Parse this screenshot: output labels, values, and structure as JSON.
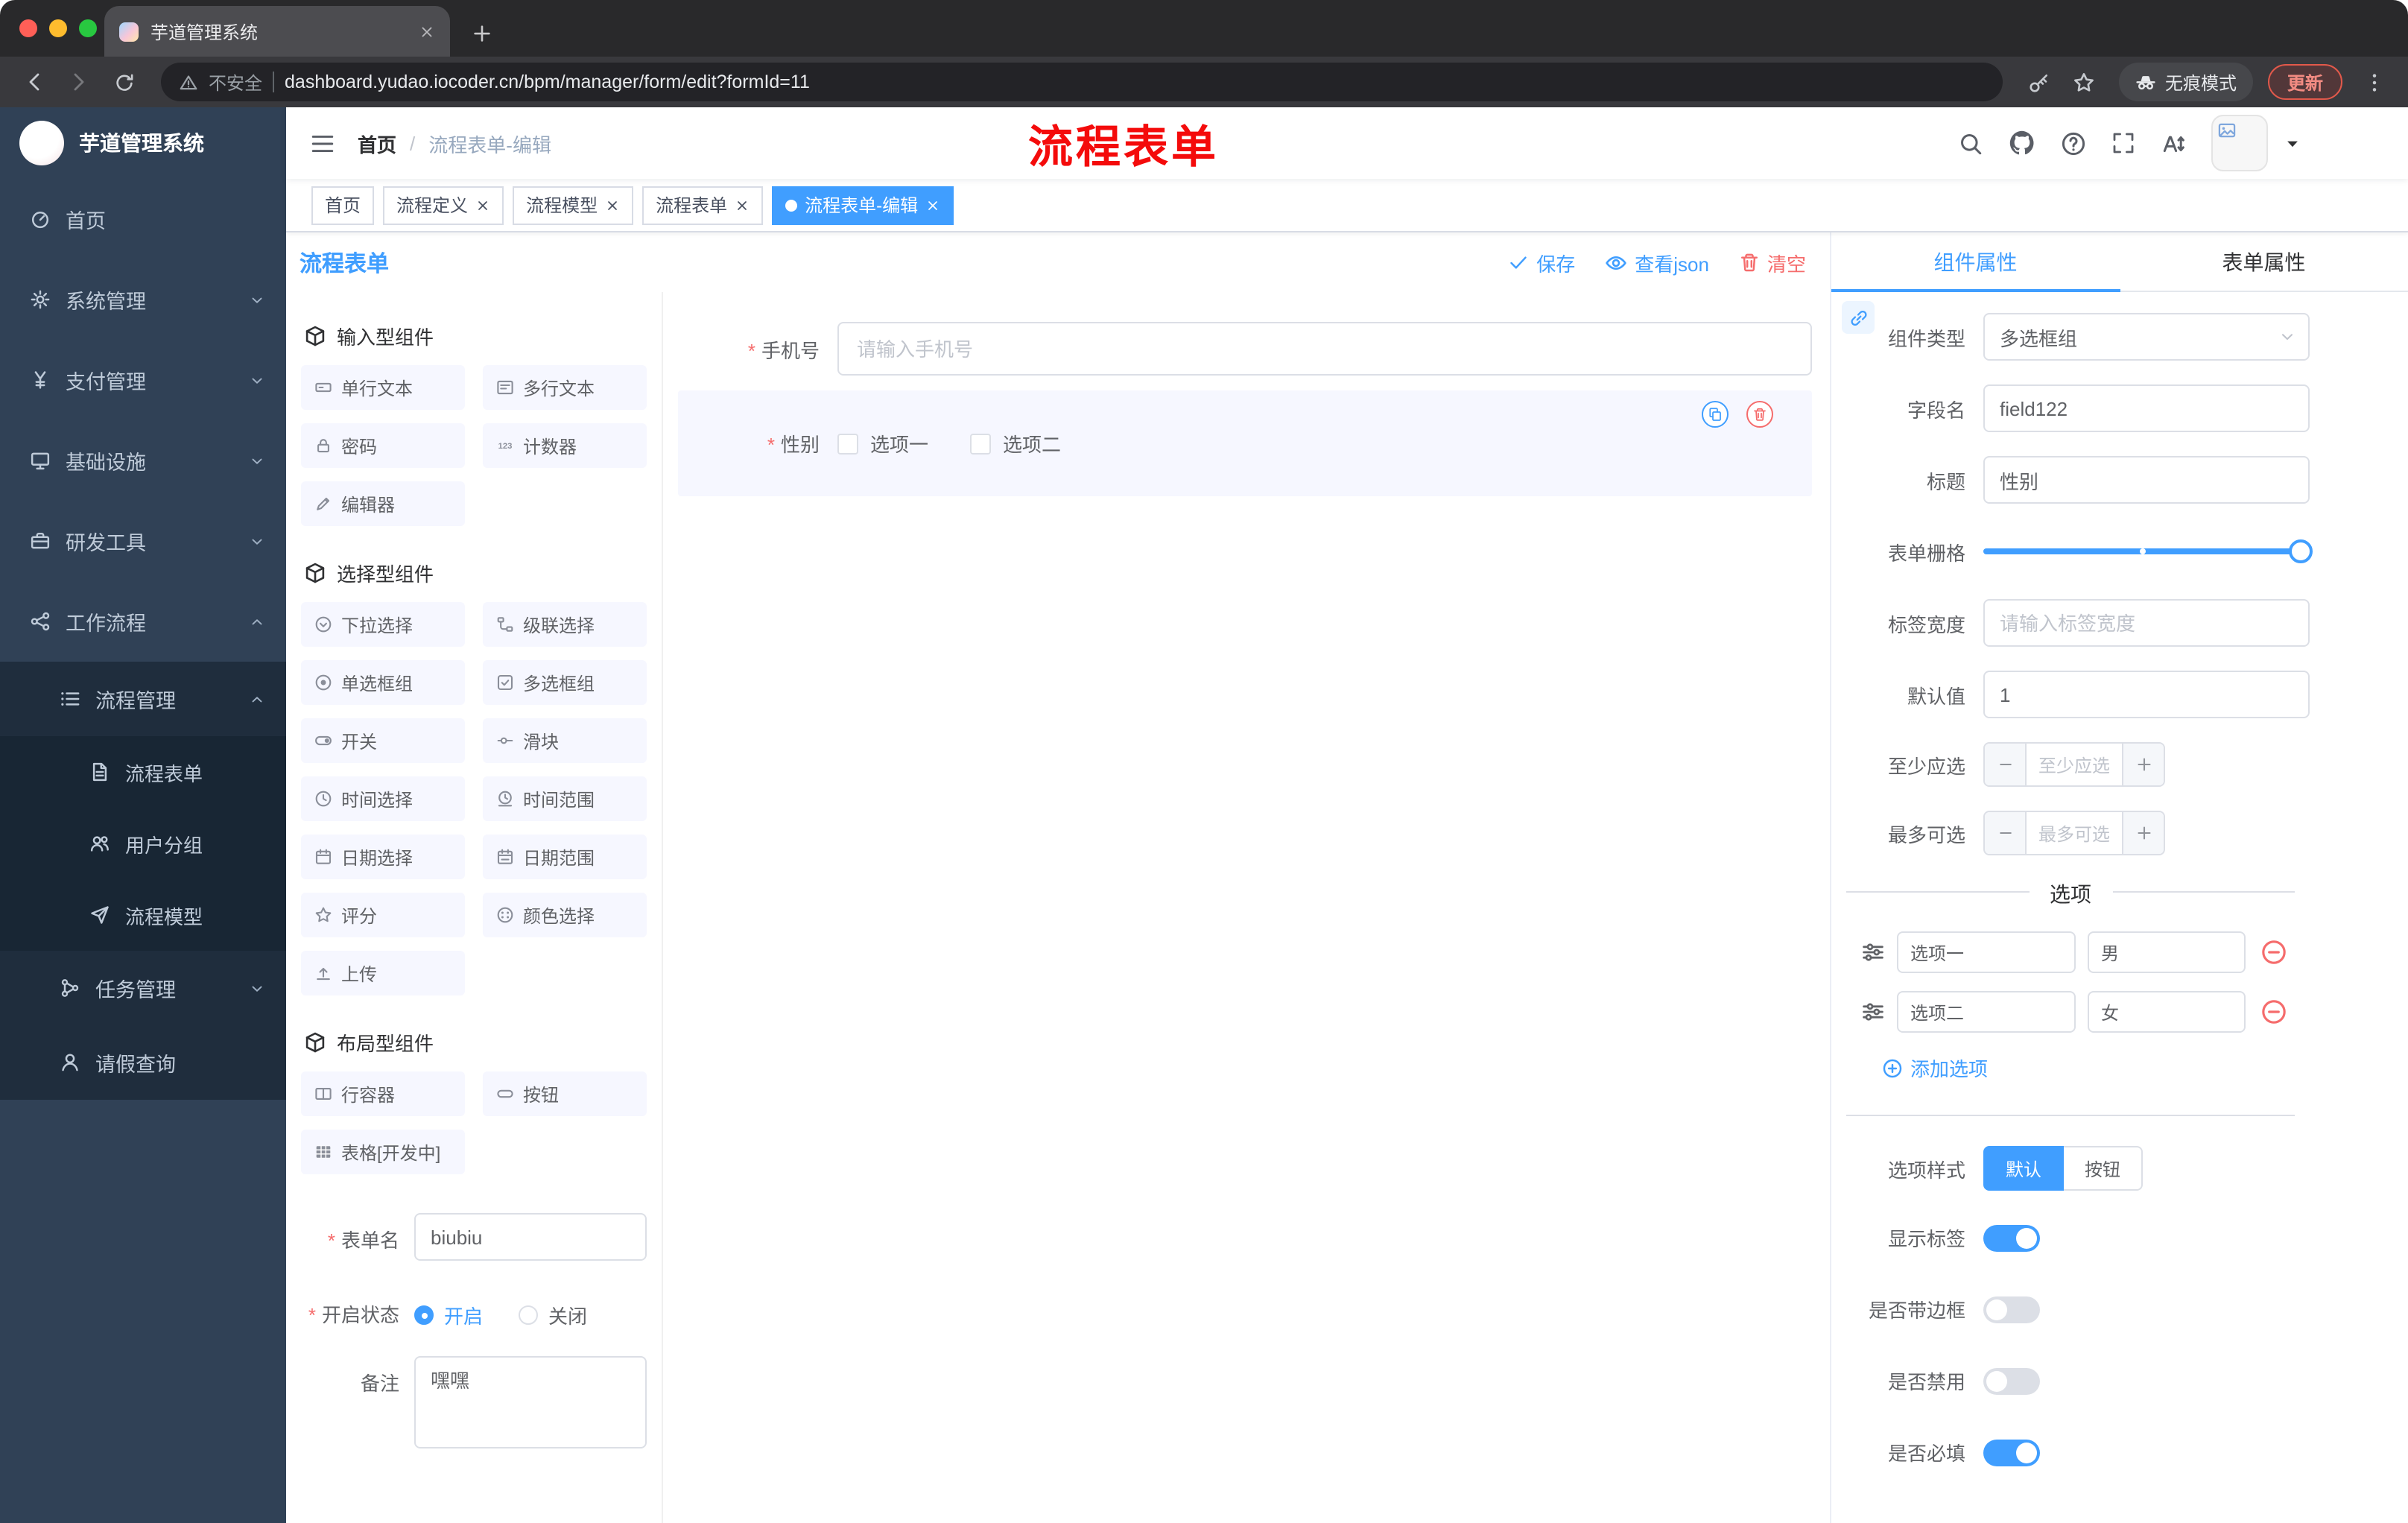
{
  "theme": {
    "primary": "#409eff",
    "danger": "#f56c6c",
    "sidebar_bg": "#304156",
    "submenu_bg": "#1f2d3d",
    "annotation_red": "#f40b0b"
  },
  "browser": {
    "tab_title": "芋道管理系统",
    "security_label": "不安全",
    "url": "dashboard.yudao.iocoder.cn/bpm/manager/form/edit?formId=11",
    "incognito_label": "无痕模式",
    "update_label": "更新"
  },
  "sidebar": {
    "app_title": "芋道管理系统",
    "items": [
      {
        "key": "home",
        "label": "首页",
        "icon": "dashboard",
        "depth": 0
      },
      {
        "key": "system",
        "label": "系统管理",
        "icon": "gear",
        "depth": 0,
        "chevron": "down"
      },
      {
        "key": "payment",
        "label": "支付管理",
        "icon": "yen",
        "depth": 0,
        "chevron": "down"
      },
      {
        "key": "infrastructure",
        "label": "基础设施",
        "icon": "infra",
        "depth": 0,
        "chevron": "down"
      },
      {
        "key": "devtools",
        "label": "研发工具",
        "icon": "toolbox",
        "depth": 0,
        "chevron": "down"
      },
      {
        "key": "workflow",
        "label": "工作流程",
        "icon": "workflow",
        "depth": 0,
        "chevron": "up",
        "open": true
      },
      {
        "key": "process-management",
        "label": "流程管理",
        "icon": "list",
        "depth": 1,
        "chevron": "up",
        "open": true
      },
      {
        "key": "process-form",
        "label": "流程表单",
        "icon": "form",
        "depth": 2,
        "active": true
      },
      {
        "key": "user-group",
        "label": "用户分组",
        "icon": "users",
        "depth": 2
      },
      {
        "key": "process-model",
        "label": "流程模型",
        "icon": "send",
        "depth": 2
      },
      {
        "key": "task-management",
        "label": "任务管理",
        "icon": "branch",
        "depth": 1,
        "chevron": "down"
      },
      {
        "key": "leave-query",
        "label": "请假查询",
        "icon": "user",
        "depth": 1
      }
    ]
  },
  "header": {
    "breadcrumb_home": "首页",
    "breadcrumb_separator": "/",
    "breadcrumb_current": "流程表单-编辑",
    "annotation": "流程表单"
  },
  "tags": [
    {
      "key": "home",
      "label": "首页",
      "closable": false,
      "active": false
    },
    {
      "key": "process-definition",
      "label": "流程定义",
      "closable": true,
      "active": false
    },
    {
      "key": "process-model",
      "label": "流程模型",
      "closable": true,
      "active": false
    },
    {
      "key": "process-form",
      "label": "流程表单",
      "closable": true,
      "active": false
    },
    {
      "key": "process-form-edit",
      "label": "流程表单-编辑",
      "closable": true,
      "active": true
    }
  ],
  "designer": {
    "title": "流程表单",
    "actions": {
      "save": "保存",
      "view_json": "查看json",
      "clear": "清空"
    },
    "palette_sections": [
      {
        "title": "输入型组件",
        "items": [
          {
            "label": "单行文本",
            "icon": "input"
          },
          {
            "label": "多行文本",
            "icon": "textarea"
          },
          {
            "label": "密码",
            "icon": "lock"
          },
          {
            "label": "计数器",
            "icon": "counter"
          },
          {
            "label": "编辑器",
            "icon": "editor"
          }
        ]
      },
      {
        "title": "选择型组件",
        "items": [
          {
            "label": "下拉选择",
            "icon": "select"
          },
          {
            "label": "级联选择",
            "icon": "cascader"
          },
          {
            "label": "单选框组",
            "icon": "radio"
          },
          {
            "label": "多选框组",
            "icon": "checkbox"
          },
          {
            "label": "开关",
            "icon": "switch"
          },
          {
            "label": "滑块",
            "icon": "slider"
          },
          {
            "label": "时间选择",
            "icon": "time"
          },
          {
            "label": "时间范围",
            "icon": "time-range"
          },
          {
            "label": "日期选择",
            "icon": "date"
          },
          {
            "label": "日期范围",
            "icon": "date-range"
          },
          {
            "label": "评分",
            "icon": "star"
          },
          {
            "label": "颜色选择",
            "icon": "color"
          },
          {
            "label": "上传",
            "icon": "upload"
          }
        ]
      },
      {
        "title": "布局型组件",
        "items": [
          {
            "label": "行容器",
            "icon": "row"
          },
          {
            "label": "按钮",
            "icon": "button"
          },
          {
            "label": "表格[开发中]",
            "icon": "table"
          }
        ]
      }
    ],
    "form_config": {
      "name_label": "表单名",
      "name_value": "biubiu",
      "status_label": "开启状态",
      "status_on": "开启",
      "status_off": "关闭",
      "status_selected": "开启",
      "remark_label": "备注",
      "remark_value": "嘿嘿"
    },
    "canvas": {
      "phone_label": "手机号",
      "phone_placeholder": "请输入手机号",
      "gender_label": "性别",
      "gender_options": [
        "选项一",
        "选项二"
      ]
    }
  },
  "properties": {
    "tabs": {
      "component": "组件属性",
      "form": "表单属性"
    },
    "component_type_label": "组件类型",
    "component_type_value": "多选框组",
    "field_name_label": "字段名",
    "field_name_value": "field122",
    "title_label": "标题",
    "title_value": "性别",
    "grid_label": "表单栅格",
    "label_width_label": "标签宽度",
    "label_width_placeholder": "请输入标签宽度",
    "default_label": "默认值",
    "default_value": "1",
    "min_label": "至少应选",
    "min_placeholder": "至少应选",
    "max_label": "最多可选",
    "max_placeholder": "最多可选",
    "options_divider": "选项",
    "option_rows": [
      {
        "name": "选项一",
        "value": "男"
      },
      {
        "name": "选项二",
        "value": "女"
      }
    ],
    "add_option": "添加选项",
    "style_label": "选项样式",
    "style_options": [
      "默认",
      "按钮"
    ],
    "style_selected": "默认",
    "toggles": [
      {
        "key": "show-label",
        "label": "显示标签",
        "on": true
      },
      {
        "key": "with-border",
        "label": "是否带边框",
        "on": false
      },
      {
        "key": "disabled",
        "label": "是否禁用",
        "on": false
      },
      {
        "key": "required",
        "label": "是否必填",
        "on": true
      }
    ]
  }
}
